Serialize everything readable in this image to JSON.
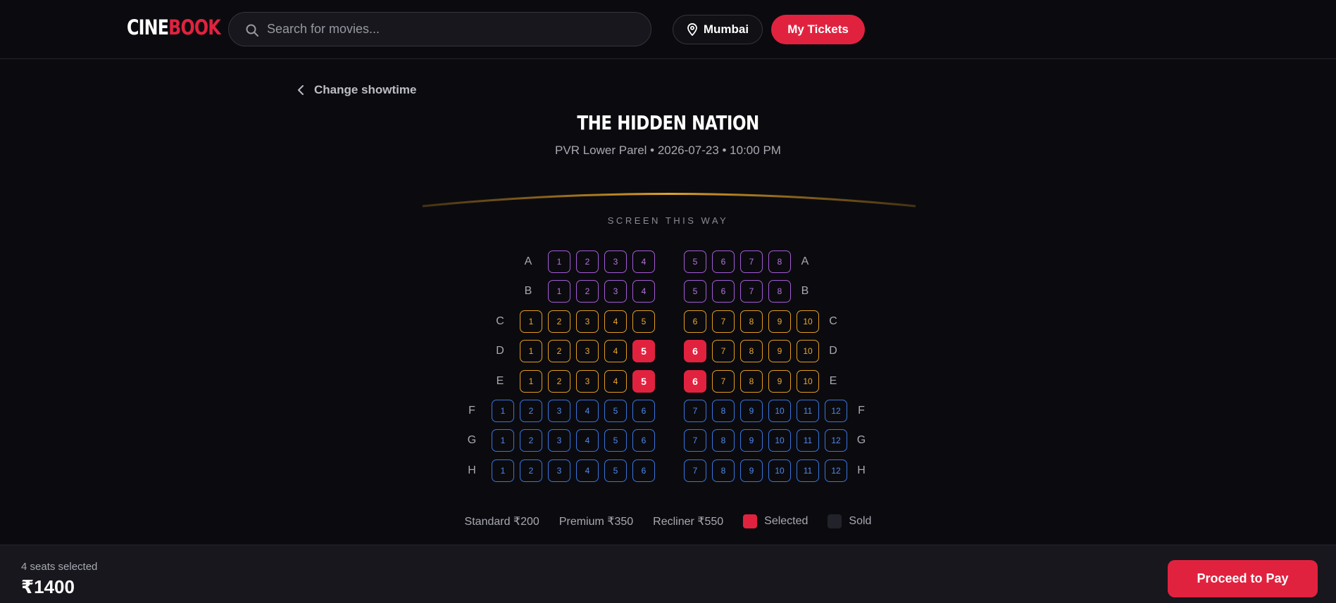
{
  "header": {
    "logo_part1": "CINE",
    "logo_part2": "BOOK",
    "search_placeholder": "Search for movies...",
    "search_value": "",
    "city": "Mumbai",
    "my_tickets_label": "My Tickets"
  },
  "back_label": "Change showtime",
  "movie": {
    "title": "THE HIDDEN NATION",
    "meta": "PVR Lower Parel • 2026-07-23 • 10:00 PM"
  },
  "screen_label": "SCREEN THIS WAY",
  "seat_rows": [
    {
      "label": "A",
      "type": "recliner",
      "left": [
        "1",
        "2",
        "3",
        "4"
      ],
      "right": [
        "5",
        "6",
        "7",
        "8"
      ],
      "selected": []
    },
    {
      "label": "B",
      "type": "recliner",
      "left": [
        "1",
        "2",
        "3",
        "4"
      ],
      "right": [
        "5",
        "6",
        "7",
        "8"
      ],
      "selected": []
    },
    {
      "label": "C",
      "type": "premium",
      "left": [
        "1",
        "2",
        "3",
        "4",
        "5"
      ],
      "right": [
        "6",
        "7",
        "8",
        "9",
        "10"
      ],
      "selected": []
    },
    {
      "label": "D",
      "type": "premium",
      "left": [
        "1",
        "2",
        "3",
        "4",
        "5"
      ],
      "right": [
        "6",
        "7",
        "8",
        "9",
        "10"
      ],
      "selected": [
        "5",
        "6"
      ]
    },
    {
      "label": "E",
      "type": "premium",
      "left": [
        "1",
        "2",
        "3",
        "4",
        "5"
      ],
      "right": [
        "6",
        "7",
        "8",
        "9",
        "10"
      ],
      "selected": [
        "5",
        "6"
      ]
    },
    {
      "label": "F",
      "type": "standard",
      "left": [
        "1",
        "2",
        "3",
        "4",
        "5",
        "6"
      ],
      "right": [
        "7",
        "8",
        "9",
        "10",
        "11",
        "12"
      ],
      "selected": []
    },
    {
      "label": "G",
      "type": "standard",
      "left": [
        "1",
        "2",
        "3",
        "4",
        "5",
        "6"
      ],
      "right": [
        "7",
        "8",
        "9",
        "10",
        "11",
        "12"
      ],
      "selected": []
    },
    {
      "label": "H",
      "type": "standard",
      "left": [
        "1",
        "2",
        "3",
        "4",
        "5",
        "6"
      ],
      "right": [
        "7",
        "8",
        "9",
        "10",
        "11",
        "12"
      ],
      "selected": []
    }
  ],
  "legend": {
    "standard": "Standard ₹200",
    "premium": "Premium ₹350",
    "recliner": "Recliner ₹550",
    "selected": "Selected",
    "sold": "Sold"
  },
  "colors": {
    "accent": "#e1223f",
    "recliner": "#a45ad6",
    "premium": "#e29c1d",
    "standard": "#3a74dc"
  },
  "footer": {
    "seats_count": "4 seats selected",
    "total": "₹1400",
    "pay_label": "Proceed to Pay"
  }
}
